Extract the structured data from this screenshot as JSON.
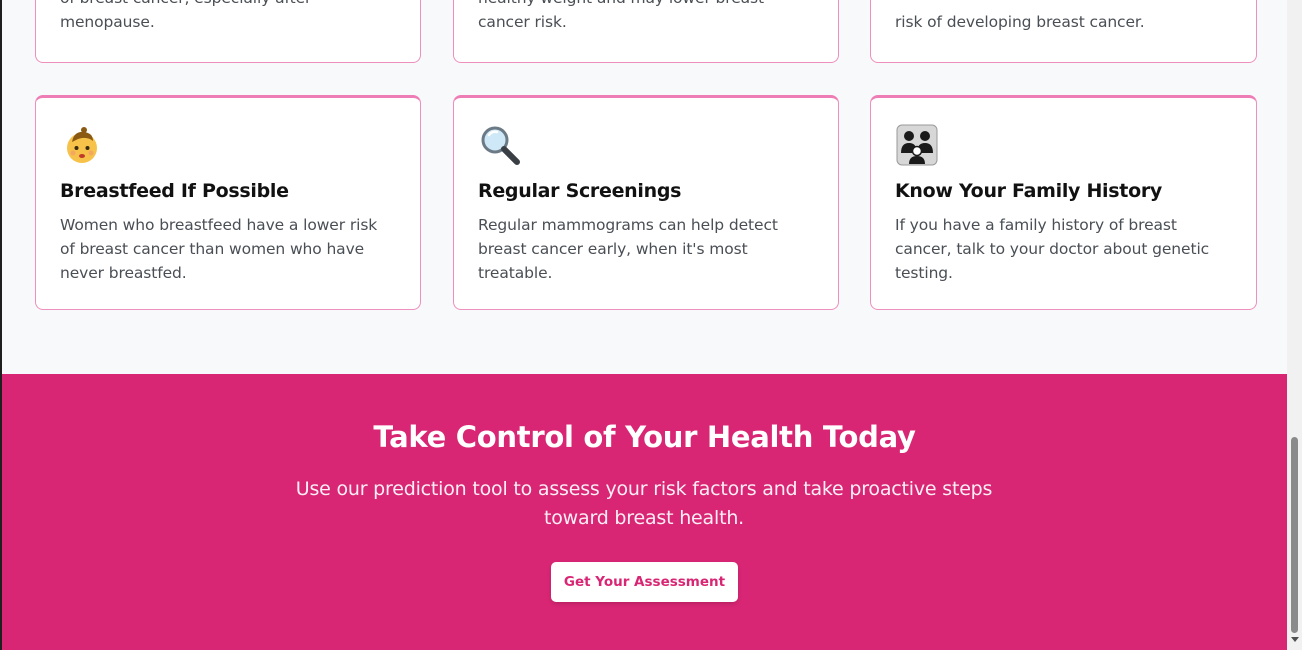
{
  "tips_top_row": [
    {
      "desc": "of breast cancer, especially after menopause."
    },
    {
      "desc": "healthy weight and may lower breast cancer risk."
    },
    {
      "desc": "risk of developing breast cancer."
    }
  ],
  "tips": [
    {
      "icon": "baby-icon",
      "title": "Breastfeed If Possible",
      "desc": "Women who breastfeed have a lower risk of breast cancer than women who have never breastfed."
    },
    {
      "icon": "magnifying-glass-icon",
      "title": "Regular Screenings",
      "desc": "Regular mammograms can help detect breast cancer early, when it's most treatable."
    },
    {
      "icon": "family-icon",
      "title": "Know Your Family History",
      "desc": "If you have a family history of breast cancer, talk to your doctor about genetic testing."
    }
  ],
  "cta": {
    "title": "Take Control of Your Health Today",
    "text": "Use our prediction tool to assess your risk factors and take proactive steps toward breast health.",
    "button_label": "Get Your Assessment"
  },
  "colors": {
    "accent": "#d92674",
    "card_border": "#ef8fbd",
    "page_bg": "#f8f9fa"
  }
}
